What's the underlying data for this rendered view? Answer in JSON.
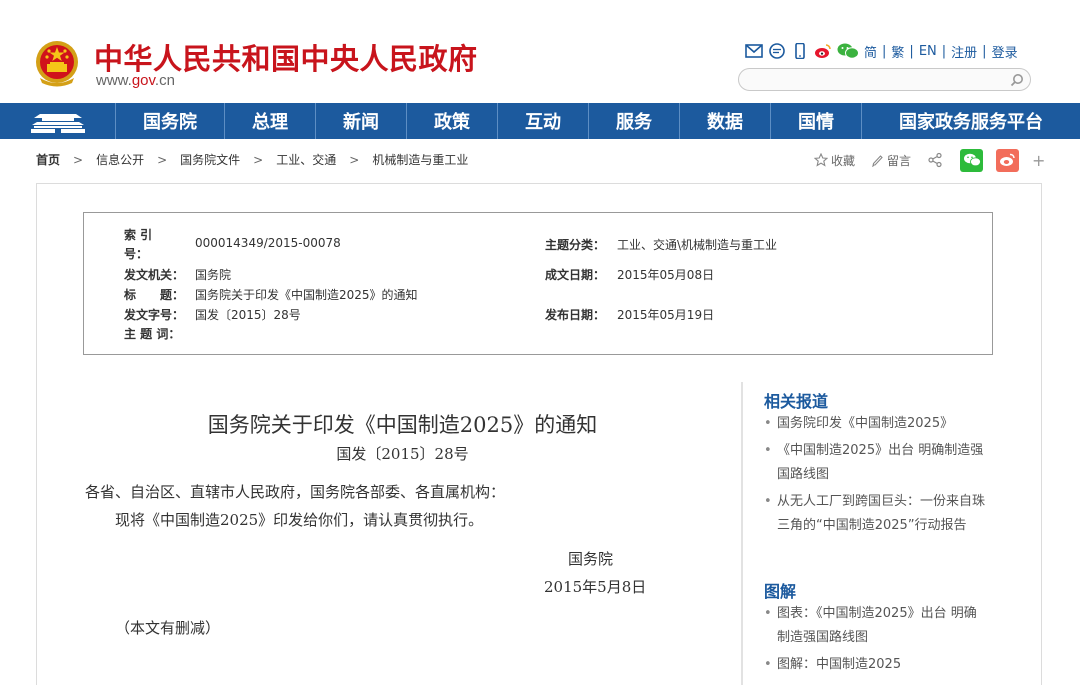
{
  "header": {
    "site_title": "中华人民共和国中央人民政府",
    "url_prefix": "www.",
    "url_domain": "gov",
    "url_suffix": ".cn",
    "lang_links": [
      "简",
      "繁",
      "EN",
      "注册",
      "登录"
    ],
    "search_placeholder": "",
    "brand_red": "#c8141c",
    "brand_blue": "#1c5a9e"
  },
  "nav": {
    "items": [
      "国务院",
      "总理",
      "新闻",
      "政策",
      "互动",
      "服务",
      "数据",
      "国情",
      "国家政务服务平台"
    ]
  },
  "breadcrumb": [
    "首页",
    "信息公开",
    "国务院文件",
    "工业、交通",
    "机械制造与重工业"
  ],
  "breadcrumb_sep": ">",
  "share": {
    "collect": "收藏",
    "comment": "留言",
    "plus": "+"
  },
  "meta": {
    "index_label": "索 引 号：",
    "index_value": "000014349/2015-00078",
    "category_label": "主题分类：",
    "category_value": "工业、交通\\机械制造与重工业",
    "issuer_label": "发文机关：",
    "issuer_value": "国务院",
    "written_label": "成文日期：",
    "written_value": "2015年05月08日",
    "title_label": "标　　题：",
    "title_value": "国务院关于印发《中国制造2025》的通知",
    "docno_label": "发文字号：",
    "docno_value": "国发〔2015〕28号",
    "published_label": "发布日期：",
    "published_value": "2015年05月19日",
    "keywords_label": "主 题 词："
  },
  "article": {
    "title": "国务院关于印发《中国制造2025》的通知",
    "doc_no": "国发〔2015〕28号",
    "salutation": "各省、自治区、直辖市人民政府，国务院各部委、各直属机构：",
    "body": "现将《中国制造2025》印发给你们，请认真贯彻执行。",
    "signature": "国务院",
    "date": "2015年5月8日",
    "note": "（本文有删减）"
  },
  "sidebar": {
    "related_heading": "相关报道",
    "related": [
      "国务院印发《中国制造2025》",
      "《中国制造2025》出台 明确制造强国路线图",
      "从无人工厂到跨国巨头：一份来自珠三角的“中国制造2025”行动报告"
    ],
    "graphic_heading": "图解",
    "graphics": [
      "图表：《中国制造2025》出台 明确制造强国路线图",
      "图解：中国制造2025"
    ]
  }
}
